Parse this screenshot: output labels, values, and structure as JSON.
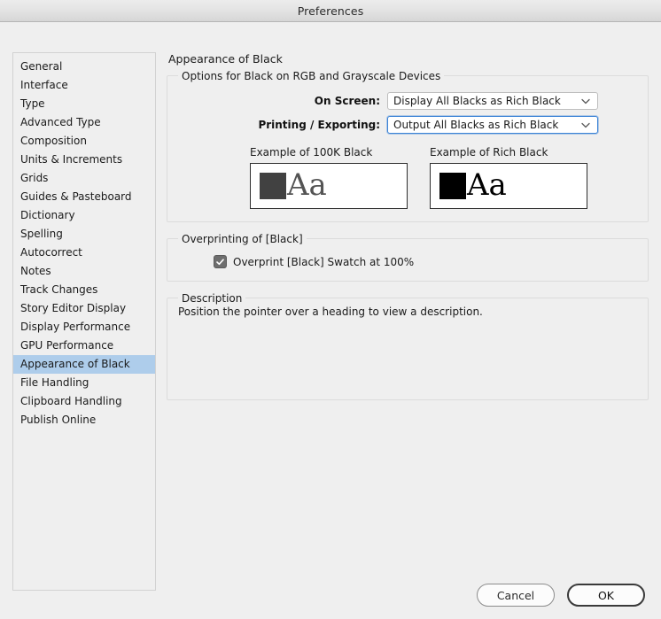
{
  "window": {
    "title": "Preferences"
  },
  "sidebar": {
    "items": [
      {
        "label": "General",
        "selected": false
      },
      {
        "label": "Interface",
        "selected": false
      },
      {
        "label": "Type",
        "selected": false
      },
      {
        "label": "Advanced Type",
        "selected": false
      },
      {
        "label": "Composition",
        "selected": false
      },
      {
        "label": "Units & Increments",
        "selected": false
      },
      {
        "label": "Grids",
        "selected": false
      },
      {
        "label": "Guides & Pasteboard",
        "selected": false
      },
      {
        "label": "Dictionary",
        "selected": false
      },
      {
        "label": "Spelling",
        "selected": false
      },
      {
        "label": "Autocorrect",
        "selected": false
      },
      {
        "label": "Notes",
        "selected": false
      },
      {
        "label": "Track Changes",
        "selected": false
      },
      {
        "label": "Story Editor Display",
        "selected": false
      },
      {
        "label": "Display Performance",
        "selected": false
      },
      {
        "label": "GPU Performance",
        "selected": false
      },
      {
        "label": "Appearance of Black",
        "selected": true
      },
      {
        "label": "File Handling",
        "selected": false
      },
      {
        "label": "Clipboard Handling",
        "selected": false
      },
      {
        "label": "Publish Online",
        "selected": false
      }
    ],
    "selection_color": "#aecdeb"
  },
  "main": {
    "title": "Appearance of Black",
    "options_group": {
      "legend": "Options for Black on RGB and Grayscale Devices",
      "on_screen": {
        "label": "On Screen:",
        "value": "Display All Blacks as Rich Black",
        "focused": false
      },
      "printing_exporting": {
        "label": "Printing / Exporting:",
        "value": "Output All Blacks as Rich Black",
        "focused": true,
        "focus_color": "#3c83d6"
      },
      "examples": [
        {
          "caption": "Example of 100K Black",
          "swatch_color": "#414141",
          "sample_text": "Aa",
          "sample_color": "#545454"
        },
        {
          "caption": "Example of Rich Black",
          "swatch_color": "#000000",
          "sample_text": "Aa",
          "sample_color": "#000000"
        }
      ]
    },
    "overprint_group": {
      "legend": "Overprinting of [Black]",
      "checkbox": {
        "label": "Overprint [Black] Swatch at 100%",
        "checked": true
      }
    },
    "description_group": {
      "legend": "Description",
      "text": "Position the pointer over a heading to view a description."
    }
  },
  "footer": {
    "cancel_label": "Cancel",
    "ok_label": "OK"
  }
}
